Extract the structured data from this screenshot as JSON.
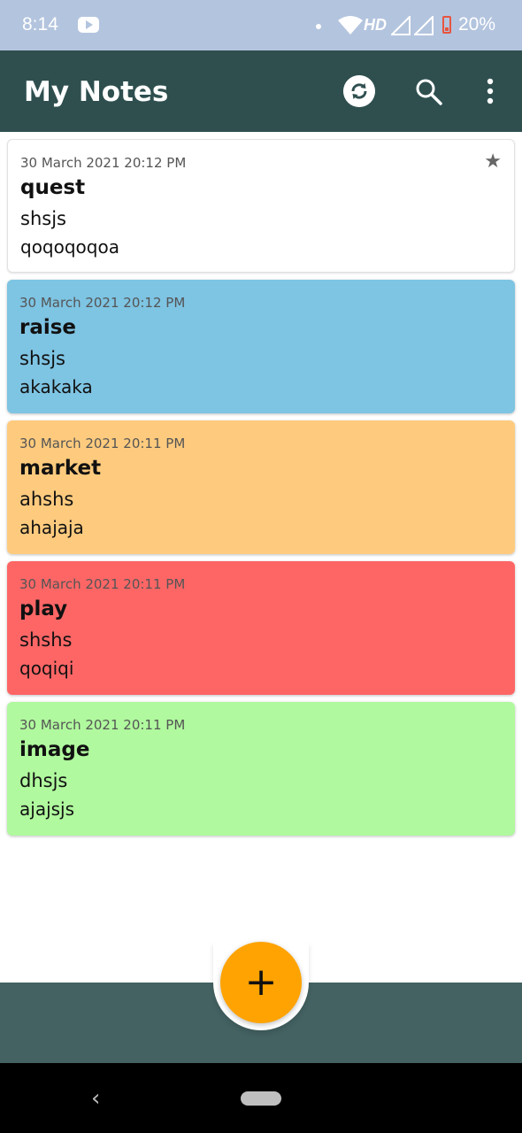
{
  "status_bar": {
    "time": "8:14",
    "network": "HD",
    "battery": "20%"
  },
  "app_bar": {
    "title": "My Notes",
    "icons": [
      "sync-icon",
      "search-icon",
      "more-vert-icon"
    ]
  },
  "notes": [
    {
      "date": "30 March 2021 20:12 PM",
      "title": "quest",
      "subtitle": "shsjs",
      "text": "qoqoqoqoa",
      "color": "#ffffff",
      "starred": true
    },
    {
      "date": "30 March 2021 20:12 PM",
      "title": "raise",
      "subtitle": "shsjs",
      "text": "akakaka",
      "color": "#7ec4e3"
    },
    {
      "date": "30 March 2021 20:11 PM",
      "title": "market",
      "subtitle": "ahshs",
      "text": "ahajaja",
      "color": "#fecb7e"
    },
    {
      "date": "30 March 2021 20:11 PM",
      "title": "play",
      "subtitle": "shshs",
      "text": "qoqiqi",
      "color": "#fe6666"
    },
    {
      "date": "30 March 2021 20:11 PM",
      "title": "image",
      "subtitle": "dhsjs",
      "text": "ajajsjs",
      "color": "#b0f99e"
    }
  ],
  "fab": {
    "label": "+",
    "color": "#fea301"
  },
  "colors": {
    "app_bar": "#2f4f4f",
    "bottom_bar": "#446262",
    "status_bar": "#b3c4de"
  }
}
